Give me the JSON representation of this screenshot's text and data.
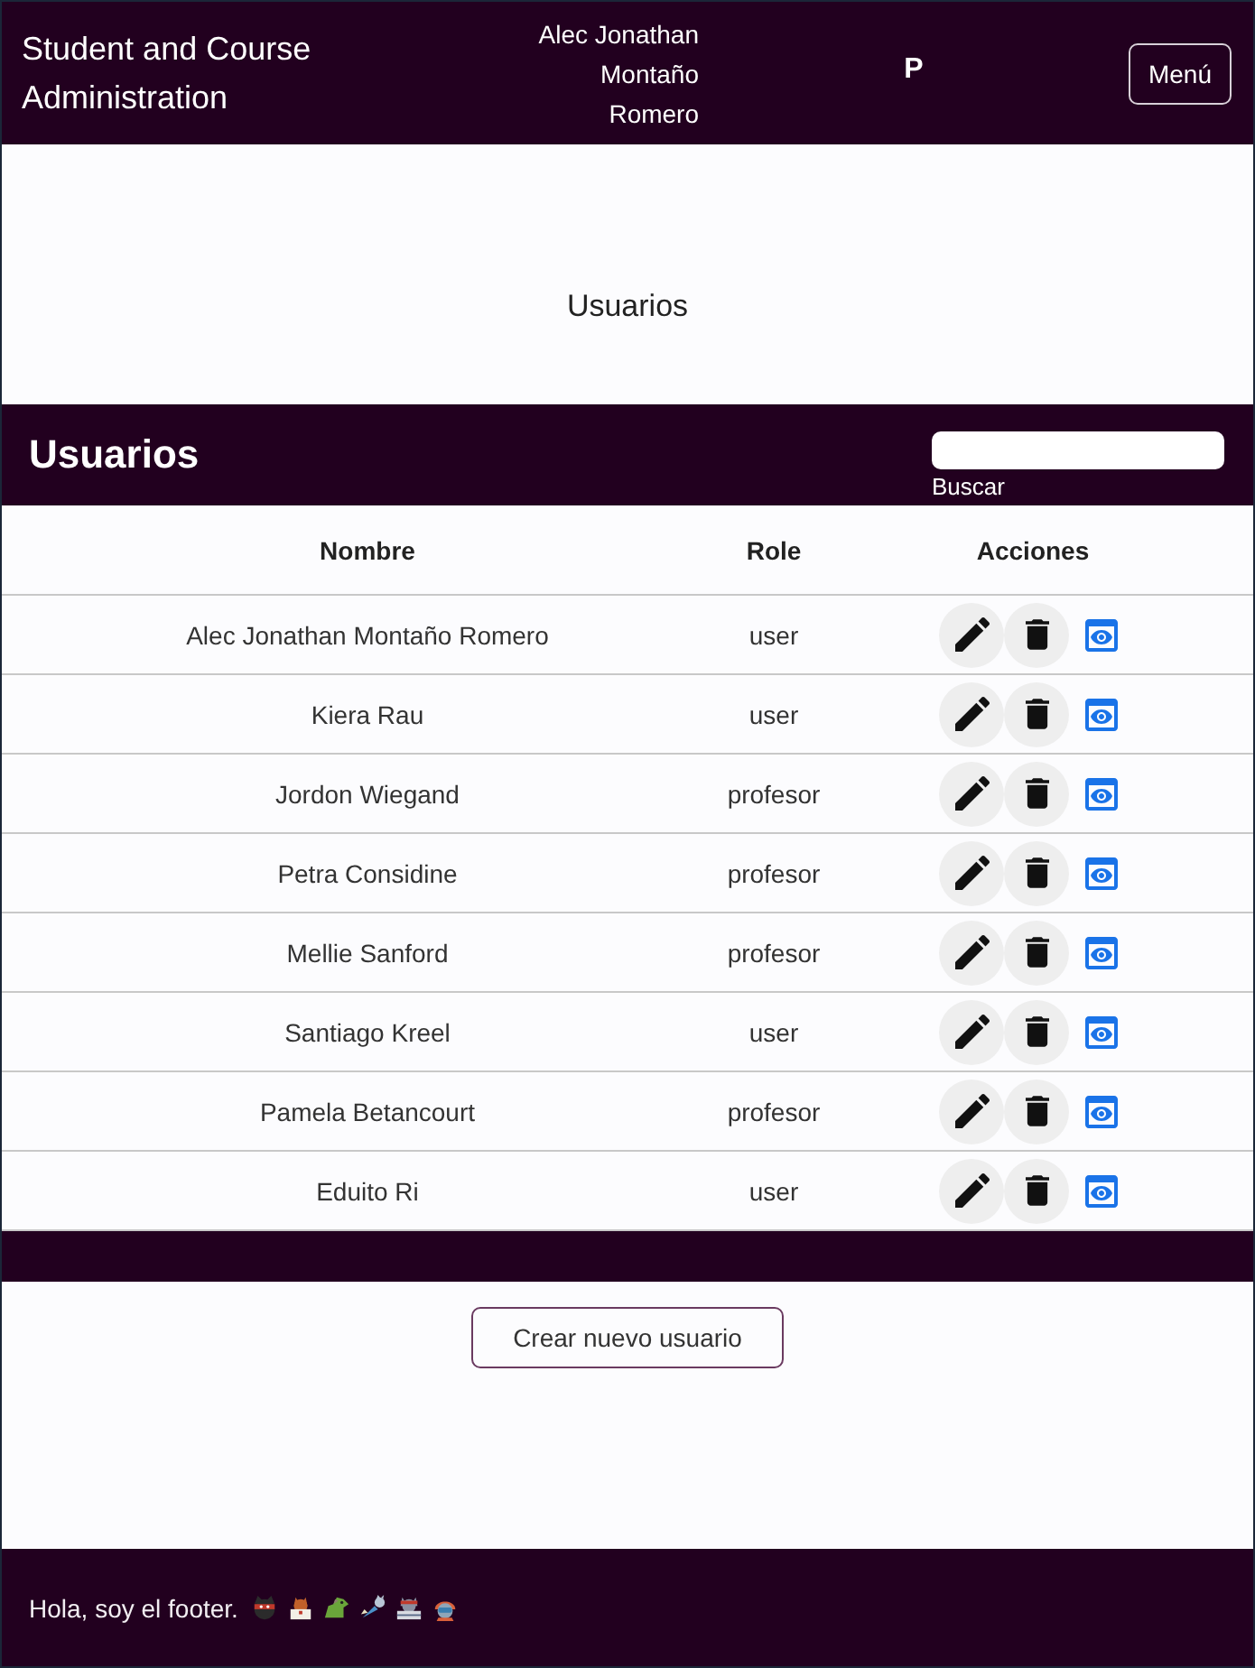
{
  "header": {
    "title": "Student and Course Administration",
    "user_name": "Alec Jonathan Montaño Romero",
    "initial": "P",
    "menu_button": "Menú"
  },
  "page_heading": "Usuarios",
  "panel": {
    "title": "Usuarios",
    "search": {
      "label": "Buscar"
    }
  },
  "table": {
    "columns": [
      "Nombre",
      "Role",
      "Acciones"
    ],
    "rows": [
      {
        "name": "Alec Jonathan Montaño Romero",
        "role": "user"
      },
      {
        "name": "Kiera Rau",
        "role": "user"
      },
      {
        "name": "Jordon Wiegand",
        "role": "profesor"
      },
      {
        "name": "Petra Considine",
        "role": "profesor"
      },
      {
        "name": "Mellie Sanford",
        "role": "profesor"
      },
      {
        "name": "Santiago Kreel",
        "role": "user"
      },
      {
        "name": "Pamela Betancourt",
        "role": "profesor"
      },
      {
        "name": "Eduito Ri",
        "role": "user"
      }
    ]
  },
  "create_button": "Crear nuevo usuario",
  "footer": {
    "text": "Hola, soy el footer."
  }
}
